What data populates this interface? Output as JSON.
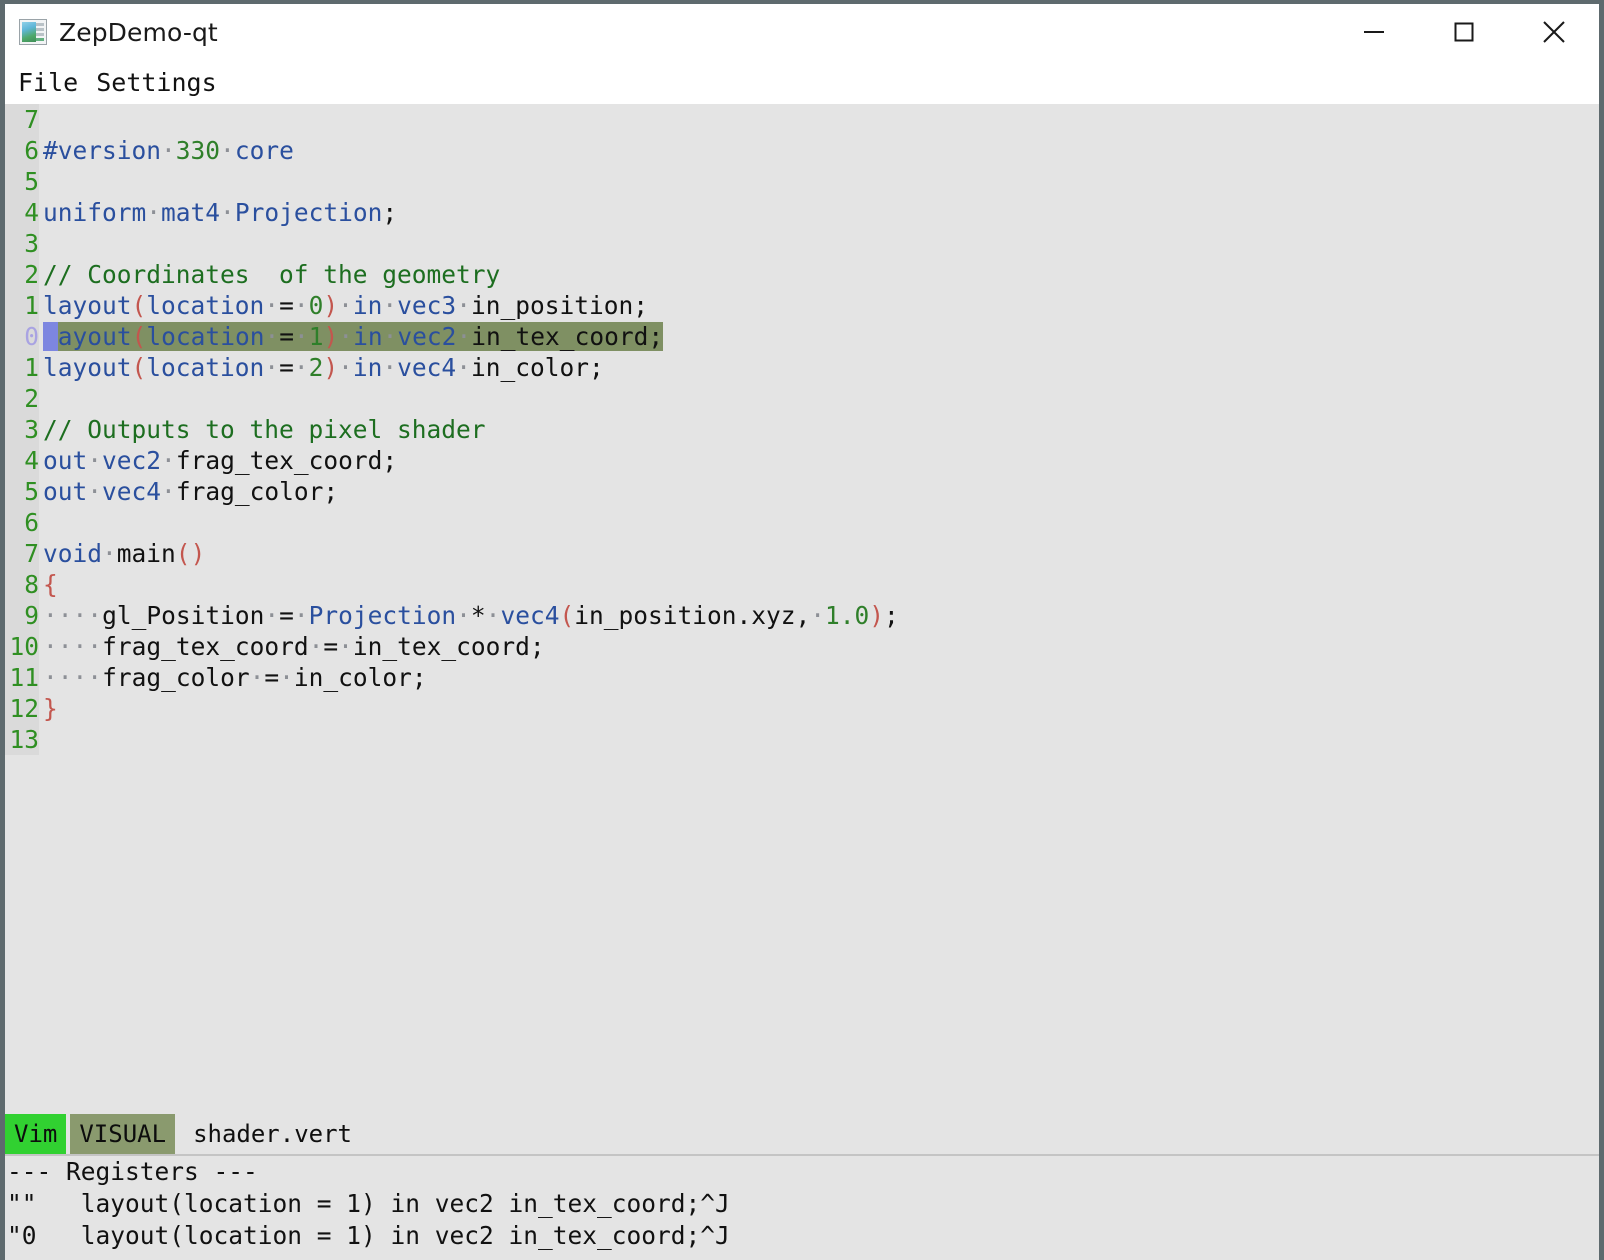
{
  "window": {
    "title": "ZepDemo-qt",
    "icon": "app-window-icon",
    "controls": [
      {
        "name": "minimize",
        "glyph": "minimize-icon"
      },
      {
        "name": "maximize",
        "glyph": "maximize-icon"
      },
      {
        "name": "close",
        "glyph": "close-icon"
      }
    ]
  },
  "menubar": {
    "items": [
      {
        "label": "File"
      },
      {
        "label": "Settings"
      }
    ]
  },
  "editor": {
    "filetype": "glsl-vertex-shader",
    "cursor_line_number": "0",
    "colors": {
      "background": "#e4e4e4",
      "gutter_background": "#dadada",
      "line_number": "#2f8f22",
      "current_line_number": "#a9a3e2",
      "selection": "#7f9063",
      "cursor": "#7d86e0",
      "keyword": "#2a4f9e",
      "number": "#2f7f2a",
      "paren": "#c3564e",
      "comment": "#1d6e20",
      "identifier": "#111111",
      "whitespace_dot": "#8d9096"
    },
    "lines": [
      {
        "num": "7",
        "text": ""
      },
      {
        "num": "6",
        "text": "#version·330·core"
      },
      {
        "num": "5",
        "text": ""
      },
      {
        "num": "4",
        "text": "uniform·mat4·Projection;"
      },
      {
        "num": "3",
        "text": ""
      },
      {
        "num": "2",
        "text": "// Coordinates  of the geometry"
      },
      {
        "num": "1",
        "text": "layout(location·=·0)·in·vec3·in_position;"
      },
      {
        "num": "0",
        "text": "layout(location·=·1)·in·vec2·in_tex_coord;"
      },
      {
        "num": "1",
        "text": "layout(location·=·2)·in·vec4·in_color;"
      },
      {
        "num": "2",
        "text": ""
      },
      {
        "num": "3",
        "text": "// Outputs to the pixel shader"
      },
      {
        "num": "4",
        "text": "out·vec2·frag_tex_coord;"
      },
      {
        "num": "5",
        "text": "out·vec4·frag_color;"
      },
      {
        "num": "6",
        "text": ""
      },
      {
        "num": "7",
        "text": "void·main()"
      },
      {
        "num": "8",
        "text": "{"
      },
      {
        "num": "9",
        "text": "····gl_Position·=·Projection·*·vec4(in_position.xyz,·1.0);"
      },
      {
        "num": "10",
        "text": "····frag_tex_coord·=·in_tex_coord;"
      },
      {
        "num": "11",
        "text": "····frag_color·=·in_color;"
      },
      {
        "num": "12",
        "text": "}"
      },
      {
        "num": "13",
        "text": ""
      }
    ]
  },
  "statusbar": {
    "editor_badge": "Vim",
    "mode_badge": "VISUAL",
    "filename": "shader.vert",
    "colors": {
      "editor_badge_bg": "#31d131",
      "mode_badge_bg": "#8a9a6e"
    }
  },
  "registers": {
    "header": "--- Registers ---",
    "entries": [
      {
        "name": "\"\"",
        "value": "layout(location = 1) in vec2 in_tex_coord;^J"
      },
      {
        "name": "\"0",
        "value": "layout(location = 1) in vec2 in_tex_coord;^J"
      }
    ]
  }
}
